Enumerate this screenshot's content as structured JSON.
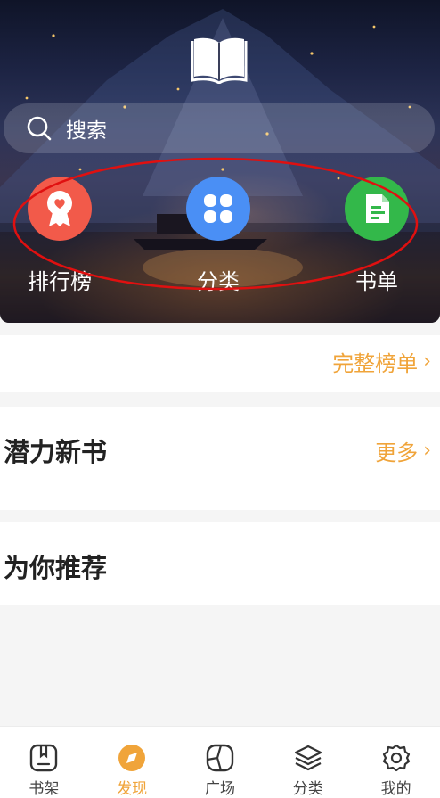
{
  "hero": {
    "search_placeholder": "搜索",
    "entries": [
      {
        "label": "排行榜",
        "icon": "ranking-badge-icon",
        "color": "#f25a4a"
      },
      {
        "label": "分类",
        "icon": "category-grid-icon",
        "color": "#4a8ff5"
      },
      {
        "label": "书单",
        "icon": "booklist-icon",
        "color": "#33b84a"
      }
    ]
  },
  "ranking": {
    "link_label": "完整榜单"
  },
  "potential": {
    "title": "潜力新书",
    "more_label": "更多"
  },
  "recommend": {
    "title": "为你推荐"
  },
  "tabbar": {
    "items": [
      {
        "label": "书架",
        "icon": "bookshelf-icon",
        "active": false
      },
      {
        "label": "发现",
        "icon": "discover-compass-icon",
        "active": true
      },
      {
        "label": "广场",
        "icon": "square-icon",
        "active": false
      },
      {
        "label": "分类",
        "icon": "layers-icon",
        "active": false
      },
      {
        "label": "我的",
        "icon": "settings-gear-icon",
        "active": false
      }
    ]
  },
  "colors": {
    "accent": "#f0a43a",
    "annotation": "#e01010"
  }
}
